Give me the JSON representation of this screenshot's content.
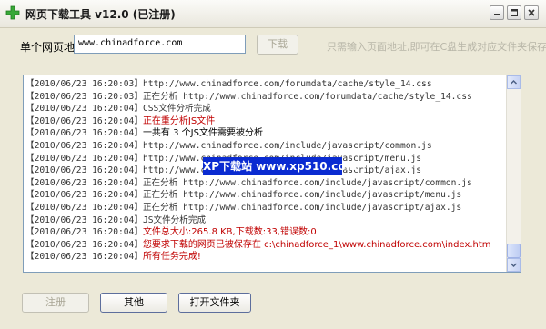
{
  "window": {
    "title": "网页下载工具 v12.0 (已注册)",
    "icon": "green-plus-icon"
  },
  "url_row": {
    "label": "单个网页地址",
    "url_value": "www.chinadforce.com",
    "download_button": "下载",
    "hint": "只需输入页面地址,即可在C盘生成对应文件夹保存"
  },
  "log": {
    "lines": [
      {
        "ts": "【2010/06/23 16:20:03】",
        "msg": "http://www.chinadforce.com/forumdata/cache/style_14.css",
        "style": "normal"
      },
      {
        "ts": "【2010/06/23 16:20:03】",
        "msg": "正在分析 http://www.chinadforce.com/forumdata/cache/style_14.css",
        "style": "normal"
      },
      {
        "ts": "【2010/06/23 16:20:04】",
        "msg": "CSS文件分析完成",
        "style": "normal"
      },
      {
        "ts": "【2010/06/23 16:20:04】",
        "msg": "正在重分析JS文件",
        "style": "red"
      },
      {
        "ts": "【2010/06/23 16:20:04】",
        "msg": "一共有 3 个JS文件需要被分析",
        "style": "black"
      },
      {
        "ts": "【2010/06/23 16:20:04】",
        "msg": "http://www.chinadforce.com/include/javascript/common.js",
        "style": "normal"
      },
      {
        "ts": "【2010/06/23 16:20:04】",
        "msg": "http://www.chinadforce.com/include/javascript/menu.js",
        "style": "normal"
      },
      {
        "ts": "【2010/06/23 16:20:04】",
        "msg": "http://www.chinadforce.com/include/javascript/ajax.js",
        "style": "normal"
      },
      {
        "ts": "【2010/06/23 16:20:04】",
        "msg": "正在分析 http://www.chinadforce.com/include/javascript/common.js",
        "style": "normal"
      },
      {
        "ts": "【2010/06/23 16:20:04】",
        "msg": "正在分析 http://www.chinadforce.com/include/javascript/menu.js",
        "style": "normal"
      },
      {
        "ts": "【2010/06/23 16:20:04】",
        "msg": "正在分析 http://www.chinadforce.com/include/javascript/ajax.js",
        "style": "normal"
      },
      {
        "ts": "【2010/06/23 16:20:04】",
        "msg": "JS文件分析完成",
        "style": "normal"
      },
      {
        "ts": "【2010/06/23 16:20:04】",
        "msg": "文件总大小:265.8 KB,下载数:33,错误数:0",
        "style": "red"
      },
      {
        "ts": "【2010/06/23 16:20:04】",
        "msg": "您要求下载的网页已被保存在 c:\\chinadforce_1\\www.chinadforce.com\\index.htm",
        "style": "red"
      },
      {
        "ts": "【2010/06/23 16:20:04】",
        "msg": "所有任务完成!",
        "style": "red"
      }
    ]
  },
  "watermark": "XP下载站 www.xp510.com",
  "buttons": {
    "register": "注册",
    "other": "其他",
    "open_folder": "打开文件夹"
  },
  "colors": {
    "accent_red": "#c00000",
    "watermark_bg": "#0a2bd1"
  }
}
